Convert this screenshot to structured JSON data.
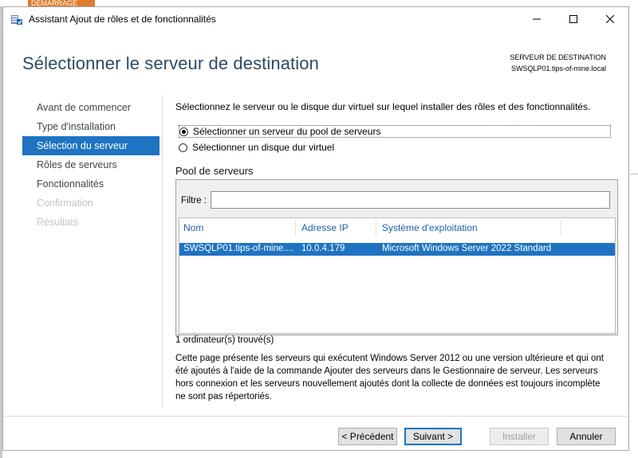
{
  "background": {
    "tab_label": "DÉMARRAGE",
    "accent_color": "#e07b2a"
  },
  "window": {
    "title": "Assistant Ajout de rôles et de fonctionnalités",
    "icon": "server-manager-icon",
    "controls": {
      "minimize": "—",
      "maximize": "☐",
      "close": "✕"
    }
  },
  "header": {
    "title": "Sélectionner le serveur de destination",
    "destination_label": "SERVEUR DE DESTINATION",
    "destination_value": "SWSQLP01.tips-of-mine.local"
  },
  "nav": {
    "items": [
      {
        "label": "Avant de commencer",
        "state": "normal"
      },
      {
        "label": "Type d'installation",
        "state": "normal"
      },
      {
        "label": "Sélection du serveur",
        "state": "active"
      },
      {
        "label": "Rôles de serveurs",
        "state": "normal"
      },
      {
        "label": "Fonctionnalités",
        "state": "normal"
      },
      {
        "label": "Confirmation",
        "state": "disabled"
      },
      {
        "label": "Résultats",
        "state": "disabled"
      }
    ]
  },
  "main": {
    "intro": "Sélectionnez le serveur ou le disque dur virtuel sur lequel installer des rôles et des fonctionnalités.",
    "options": [
      {
        "label": "Sélectionner un serveur du pool de serveurs",
        "checked": true
      },
      {
        "label": "Sélectionner un disque dur virtuel",
        "checked": false
      }
    ],
    "pool": {
      "title": "Pool de serveurs",
      "filter_label": "Filtre :",
      "filter_value": "",
      "columns": [
        "Nom",
        "Adresse IP",
        "Système d'exploitation"
      ],
      "rows": [
        {
          "name": "SWSQLP01.tips-of-mine....",
          "ip": "10.0.4.179",
          "os": "Microsoft Windows Server 2022 Standard",
          "selected": true
        }
      ]
    },
    "count": "1 ordinateur(s) trouvé(s)",
    "description": "Cette page présente les serveurs qui exécutent Windows Server 2012 ou une version ultérieure et qui ont été ajoutés à l'aide de la commande Ajouter des serveurs dans le Gestionnaire de serveur. Les serveurs hors connexion et les serveurs nouvellement ajoutés dont la collecte de données est toujours incomplète ne sont pas répertoriés."
  },
  "buttons": {
    "previous": "< Précédent",
    "next": "Suivant >",
    "install": "Installer",
    "cancel": "Annuler"
  },
  "colors": {
    "selection": "#1e73c2",
    "title": "#2b4a63",
    "column_header": "#1f5fa8"
  }
}
